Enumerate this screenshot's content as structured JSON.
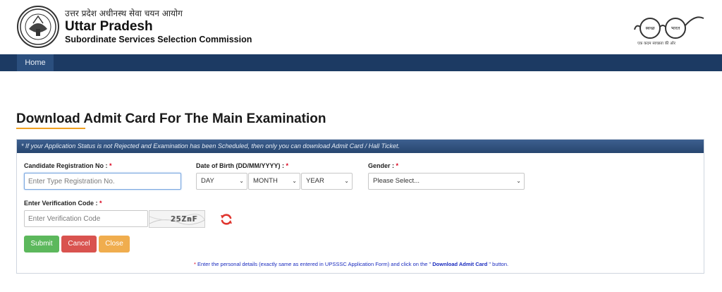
{
  "header": {
    "hindi_name": "उत्तर प्रदेश अधीनस्थ सेवा चयन आयोग",
    "title": "Uttar Pradesh",
    "subtitle": "Subordinate Services Selection Commission",
    "swachh_left": "स्वच्छ",
    "swachh_right": "भारत",
    "swachh_tagline": "एक कदम स्वच्छता की ओर"
  },
  "nav": {
    "home": "Home"
  },
  "page": {
    "title": "Download Admit Card For The Main Examination"
  },
  "notice": "* If your Application Status is not Rejected and Examination has been Scheduled, then only you can download Admit Card / Hall Ticket.",
  "form": {
    "reg_label": "Candidate Registration No :",
    "reg_placeholder": "Enter Type Registration No.",
    "dob_label": "Date of Birth (DD/MM/YYYY) :",
    "day": "DAY",
    "month": "MONTH",
    "year": "YEAR",
    "gender_label": "Gender :",
    "gender": "Please Select...",
    "verification_label": "Enter Verification Code :",
    "verification_placeholder": "Enter Verification Code",
    "captcha": "25ZnF",
    "required_mark": "*"
  },
  "buttons": {
    "submit": "Submit",
    "cancel": "Cancel",
    "close": "Close"
  },
  "footnote": {
    "star": "*",
    "text_before": " Enter the personal details (exactly same as entered in UPSSSC Application Form) and click on the \"",
    "bold": " Download Admit Card",
    "text_after": " \" button."
  },
  "colors": {
    "navbar": "#1c3a63",
    "accent_underline": "#f0a020",
    "submit": "#5cb85c",
    "cancel": "#d9534f",
    "close": "#f0ad4e",
    "required": "#d9001b"
  },
  "icons": {
    "logo": "up-emblem-icon",
    "swachh": "swachh-bharat-glasses-icon",
    "refresh": "refresh-icon",
    "chevron": "chevron-down-icon"
  }
}
